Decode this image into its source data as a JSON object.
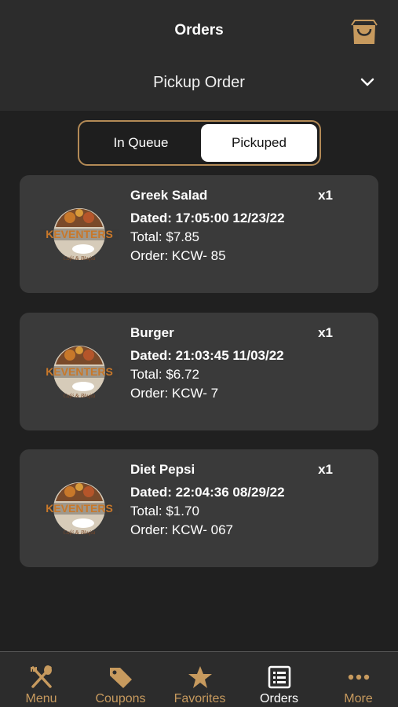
{
  "header": {
    "title": "Orders",
    "cart_icon": "shopping-bag-icon"
  },
  "order_type": {
    "label": "Pickup Order",
    "icon": "chevron-down-icon"
  },
  "segment": {
    "tabs": [
      {
        "label": "In Queue"
      },
      {
        "label": "Pickuped"
      }
    ],
    "active": "Pickuped"
  },
  "orders": [
    {
      "name": "Greek Salad",
      "qty": "x1",
      "dated": "Dated: 17:05:00 12/23/22",
      "total": "Total: $7.85",
      "order_no": "Order: KCW- 85"
    },
    {
      "name": "Burger",
      "qty": "x1",
      "dated": "Dated: 21:03:45 11/03/22",
      "total": "Total: $6.72",
      "order_no": "Order: KCW- 7"
    },
    {
      "name": "Diet Pepsi",
      "qty": "x1",
      "dated": "Dated: 22:04:36 08/29/22",
      "total": "Total: $1.70",
      "order_no": "Order: KCW- 067"
    }
  ],
  "brand": {
    "logo_text": "KEVENTERS",
    "logo_subtext": "Café & Bhujia"
  },
  "tabbar": {
    "items": [
      {
        "label": "Menu",
        "icon": "fork-spoon-icon"
      },
      {
        "label": "Coupons",
        "icon": "tag-icon"
      },
      {
        "label": "Favorites",
        "icon": "star-icon"
      },
      {
        "label": "Orders",
        "icon": "list-icon"
      },
      {
        "label": "More",
        "icon": "more-dots-icon"
      }
    ],
    "active": "Orders"
  },
  "colors": {
    "accent": "#c79a5e",
    "card": "#3a3a3a",
    "background": "#202020",
    "header": "#2c2c2c"
  }
}
